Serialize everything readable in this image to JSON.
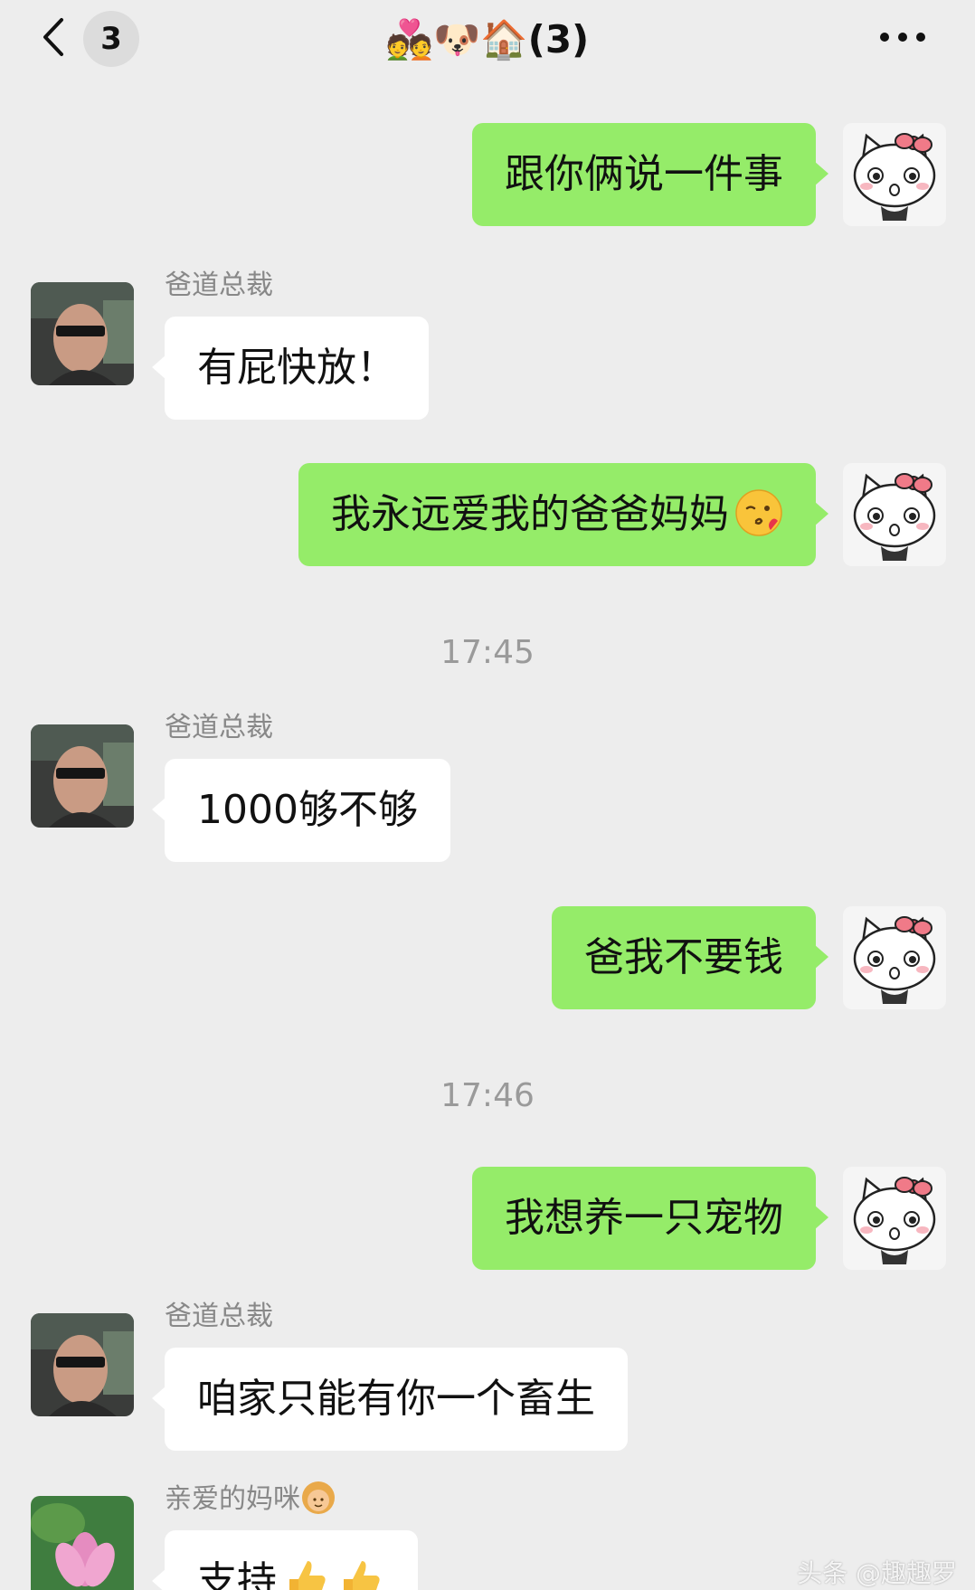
{
  "header": {
    "back_icon": "chevron-left-icon",
    "unread_count": "3",
    "title": "💑🐶🏠(3)",
    "more_icon": "more-dots-icon"
  },
  "messages": [
    {
      "side": "out",
      "text": "跟你俩说一件事"
    },
    {
      "side": "in",
      "sender": "爸道总裁",
      "text": "有屁快放！"
    },
    {
      "side": "out",
      "text": "我永远爱我的爸爸妈妈",
      "emoji": "kissing-face-emoji"
    },
    {
      "type": "time",
      "text": "17:45"
    },
    {
      "side": "in",
      "sender": "爸道总裁",
      "text": "1000够不够"
    },
    {
      "side": "out",
      "text": "爸我不要钱"
    },
    {
      "type": "time",
      "text": "17:46"
    },
    {
      "side": "out",
      "text": "我想养一只宠物"
    },
    {
      "side": "in",
      "sender": "爸道总裁",
      "text": "咱家只能有你一个畜生"
    },
    {
      "side": "in",
      "sender": "亲爱的妈咪",
      "sender_emoji": "woman-emoji",
      "text": "支持",
      "emoji": "thumbs-up-emoji"
    }
  ],
  "watermark": "头条 @趣趣罗"
}
